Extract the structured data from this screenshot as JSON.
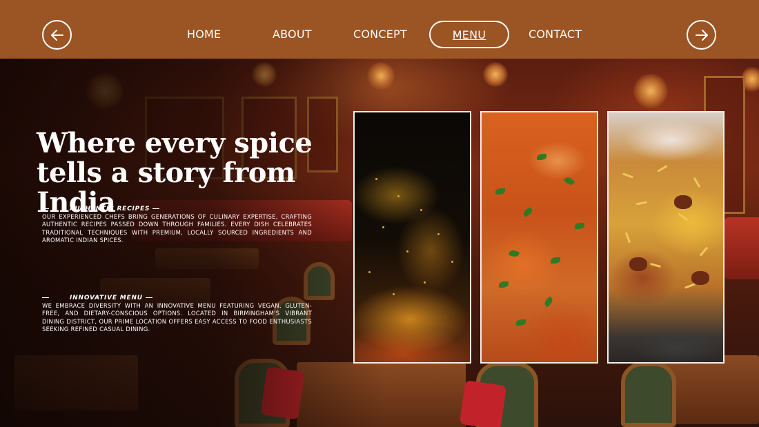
{
  "nav": {
    "prev_icon": "arrow-left-icon",
    "next_icon": "arrow-right-icon",
    "links": [
      {
        "label": "HOME"
      },
      {
        "label": "ABOUT"
      },
      {
        "label": "CONCEPT"
      },
      {
        "label": "MENU",
        "active": true
      },
      {
        "label": "CONTACT"
      }
    ]
  },
  "hero": {
    "headline": "Where every spice tells a story from India",
    "features": [
      {
        "title": "AUTHENTIC RECIPES",
        "body": "OUR EXPERIENCED CHEFS BRING GENERATIONS OF CULINARY EXPERTISE, CRAFTING AUTHENTIC RECIPES PASSED DOWN THROUGH FAMILIES. EVERY DISH CELEBRATES TRADITIONAL TECHNIQUES WITH PREMIUM, LOCALLY SOURCED INGREDIENTS AND AROMATIC INDIAN SPICES."
      },
      {
        "title": "INNOVATIVE MENU",
        "body": "WE EMBRACE DIVERSITY WITH AN INNOVATIVE MENU FEATURING VEGAN, GLUTEN-FREE, AND DIETARY-CONSCIOUS OPTIONS. LOCATED IN BIRMINGHAM'S VIBRANT DINING DISTRICT, OUR PRIME LOCATION OFFERS EASY ACCESS TO FOOD ENTHUSIASTS SEEKING REFINED CASUAL DINING."
      }
    ]
  },
  "colors": {
    "header_bg": "#9b5424",
    "text": "#ffffff",
    "photo_border": "#f3efe8"
  }
}
